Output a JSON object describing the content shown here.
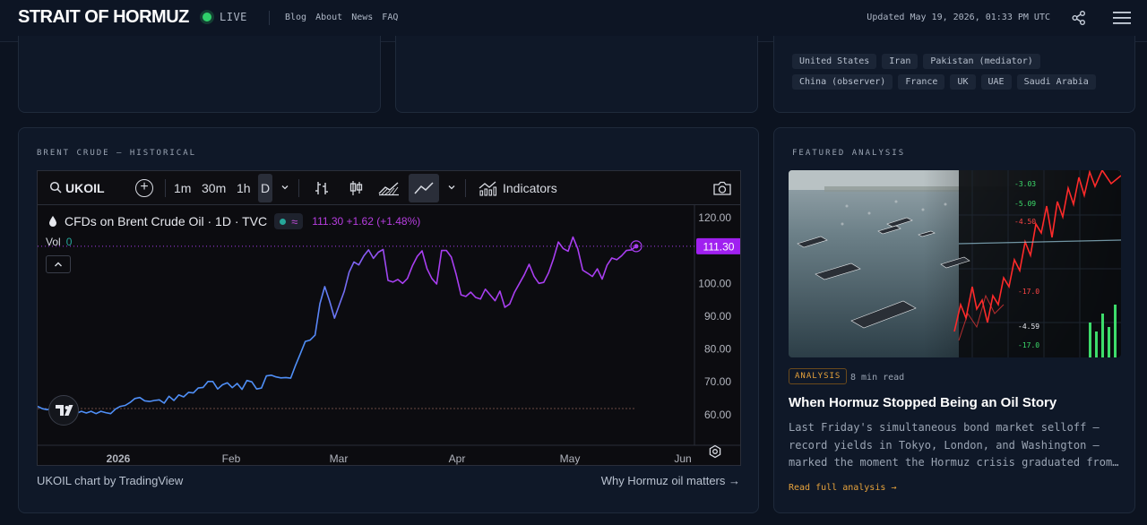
{
  "header": {
    "brand": "STRAIT OF HORMUZ",
    "live": "LIVE",
    "nav": [
      "Blog",
      "About",
      "News",
      "FAQ"
    ],
    "updated": "Updated May 19, 2026, 01:33 PM UTC",
    "colors": {
      "live": "#2fd16a",
      "accent": "#e6a23c"
    }
  },
  "parties": {
    "tags": [
      "United States",
      "Iran",
      "Pakistan (mediator)",
      "China (observer)",
      "France",
      "UK",
      "UAE",
      "Saudi Arabia"
    ]
  },
  "brent": {
    "label": "BRENT CRUDE — HISTORICAL",
    "toolbar": {
      "symbol": "UKOIL",
      "intervals": [
        "1m",
        "30m",
        "1h"
      ],
      "active_interval": "D",
      "indicators": "Indicators"
    },
    "legend": {
      "title": "CFDs on Brent Crude Oil · 1D · TVC",
      "quote": "111.30 +1.62 (+1.48%)",
      "vol_label": "Vol",
      "vol_value": "0"
    },
    "footer_left": "UKOIL chart by TradingView",
    "footer_right": "Why Hormuz oil matters →"
  },
  "chart_data": {
    "type": "line",
    "x_labels": [
      "2026",
      "Feb",
      "Mar",
      "Apr",
      "May",
      "Jun"
    ],
    "y_ticks": [
      "120.00",
      "110.00",
      "100.00",
      "90.00",
      "80.00",
      "70.00",
      "60.00"
    ],
    "ylim": [
      55,
      123
    ],
    "last_price": "111.30",
    "line_colors": [
      "#4f8ff7",
      "#a83ef0"
    ],
    "values": [
      62.5,
      61.8,
      61.5,
      62.0,
      61.3,
      61.8,
      61.7,
      61.2,
      60.4,
      61.0,
      60.5,
      61.0,
      60.3,
      61.0,
      60.6,
      60.3,
      61.7,
      62.5,
      62.8,
      63.7,
      64.9,
      65.2,
      64.2,
      64.0,
      64.3,
      64.5,
      63.5,
      65.6,
      64.3,
      66.0,
      65.4,
      66.8,
      66.6,
      68.1,
      68.3,
      70.1,
      70.1,
      67.8,
      69.1,
      69.7,
      68.2,
      69.5,
      67.7,
      70.4,
      70.0,
      67.8,
      68.1,
      71.8,
      72.0,
      71.5,
      71.2,
      71.3,
      71.1,
      75.0,
      78.6,
      82.3,
      82.7,
      84.2,
      93.8,
      99.0,
      94.5,
      89.4,
      93.5,
      97.5,
      103.4,
      106.5,
      105.6,
      108.3,
      110.2,
      107.6,
      109.5,
      110.3,
      100.9,
      100.4,
      101.2,
      100.0,
      101.5,
      105.3,
      108.2,
      109.9,
      104.5,
      101.5,
      99.8,
      110.0,
      110.0,
      108.0,
      102.7,
      96.5,
      96.0,
      97.3,
      95.7,
      95.2,
      98.2,
      96.4,
      94.7,
      97.6,
      92.7,
      93.7,
      97.3,
      100.0,
      102.6,
      105.8,
      102.1,
      100.0,
      100.3,
      103.2,
      107.5,
      112.6,
      110.6,
      109.8,
      114.1,
      110.5,
      104.0,
      103.1,
      102.1,
      104.4,
      101.3,
      105.5,
      107.7,
      107.2,
      108.4,
      110.0,
      110.2,
      111.3
    ]
  },
  "featured": {
    "label": "FEATURED ANALYSIS",
    "badge": "ANALYSIS",
    "read_time": "8 min read",
    "title": "When Hormuz Stopped Being an Oil Story",
    "description": "Last Friday's simultaneous bond market selloff — record yields in Tokyo, London, and Washington — marked the moment the Hormuz crisis graduated from an energy shock into a macro event.",
    "link": "Read full analysis →",
    "image_ticker_labels": [
      "-3.03",
      "-5.09",
      "-4.50",
      "-17.0",
      "-4.59",
      "-17.0"
    ]
  }
}
